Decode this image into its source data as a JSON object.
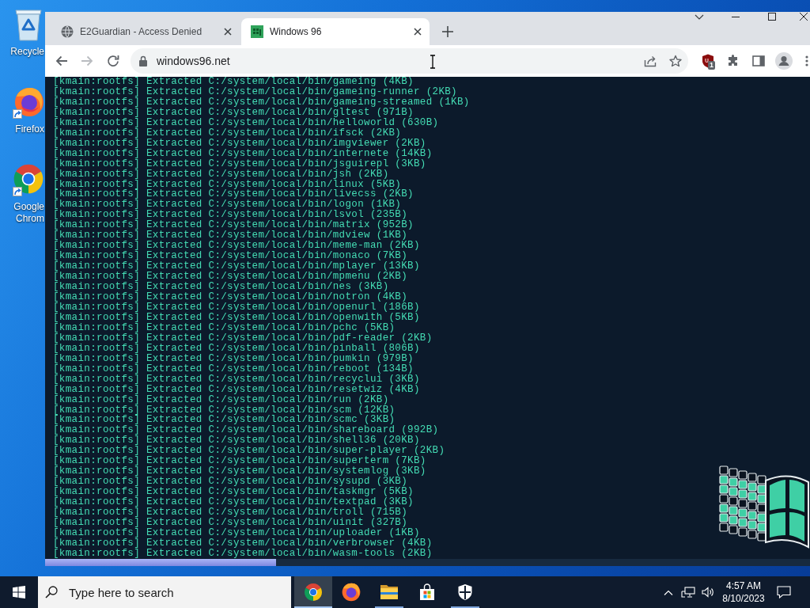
{
  "desktop": {
    "icons": [
      {
        "label": "Recycle",
        "shortcut": false
      },
      {
        "label": "Firefox",
        "shortcut": true
      },
      {
        "label": "Google Chrom",
        "shortcut": true
      }
    ]
  },
  "tabs": [
    {
      "title": "E2Guardian - Access Denied",
      "selected": false
    },
    {
      "title": "Windows 96",
      "selected": true
    }
  ],
  "toolbar": {
    "back_disabled": false,
    "forward_disabled": true,
    "url": "windows96.net",
    "extension_badge": "1"
  },
  "terminal": {
    "lines": [
      "[kmain:rootfs] Extracted C:/system/local/bin/gameing (4KB)",
      "[kmain:rootfs] Extracted C:/system/local/bin/gameing-runner (2KB)",
      "[kmain:rootfs] Extracted C:/system/local/bin/gameing-streamed (1KB)",
      "[kmain:rootfs] Extracted C:/system/local/bin/gltest (971B)",
      "[kmain:rootfs] Extracted C:/system/local/bin/helloworld (630B)",
      "[kmain:rootfs] Extracted C:/system/local/bin/ifsck (2KB)",
      "[kmain:rootfs] Extracted C:/system/local/bin/imgviewer (2KB)",
      "[kmain:rootfs] Extracted C:/system/local/bin/internete (14KB)",
      "[kmain:rootfs] Extracted C:/system/local/bin/jsguirepl (3KB)",
      "[kmain:rootfs] Extracted C:/system/local/bin/jsh (2KB)",
      "[kmain:rootfs] Extracted C:/system/local/bin/linux (5KB)",
      "[kmain:rootfs] Extracted C:/system/local/bin/livecss (2KB)",
      "[kmain:rootfs] Extracted C:/system/local/bin/logon (1KB)",
      "[kmain:rootfs] Extracted C:/system/local/bin/lsvol (235B)",
      "[kmain:rootfs] Extracted C:/system/local/bin/matrix (952B)",
      "[kmain:rootfs] Extracted C:/system/local/bin/mdview (1KB)",
      "[kmain:rootfs] Extracted C:/system/local/bin/meme-man (2KB)",
      "[kmain:rootfs] Extracted C:/system/local/bin/monaco (7KB)",
      "[kmain:rootfs] Extracted C:/system/local/bin/mplayer (13KB)",
      "[kmain:rootfs] Extracted C:/system/local/bin/mpmenu (2KB)",
      "[kmain:rootfs] Extracted C:/system/local/bin/nes (3KB)",
      "[kmain:rootfs] Extracted C:/system/local/bin/notron (4KB)",
      "[kmain:rootfs] Extracted C:/system/local/bin/openurl (186B)",
      "[kmain:rootfs] Extracted C:/system/local/bin/openwith (5KB)",
      "[kmain:rootfs] Extracted C:/system/local/bin/pchc (5KB)",
      "[kmain:rootfs] Extracted C:/system/local/bin/pdf-reader (2KB)",
      "[kmain:rootfs] Extracted C:/system/local/bin/pinball (806B)",
      "[kmain:rootfs] Extracted C:/system/local/bin/pumkin (979B)",
      "[kmain:rootfs] Extracted C:/system/local/bin/reboot (134B)",
      "[kmain:rootfs] Extracted C:/system/local/bin/recyclui (3KB)",
      "[kmain:rootfs] Extracted C:/system/local/bin/resetwiz (4KB)",
      "[kmain:rootfs] Extracted C:/system/local/bin/run (2KB)",
      "[kmain:rootfs] Extracted C:/system/local/bin/scm (12KB)",
      "[kmain:rootfs] Extracted C:/system/local/bin/scmc (3KB)",
      "[kmain:rootfs] Extracted C:/system/local/bin/shareboard (992B)",
      "[kmain:rootfs] Extracted C:/system/local/bin/shell36 (20KB)",
      "[kmain:rootfs] Extracted C:/system/local/bin/super-player (2KB)",
      "[kmain:rootfs] Extracted C:/system/local/bin/superterm (7KB)",
      "[kmain:rootfs] Extracted C:/system/local/bin/systemlog (3KB)",
      "[kmain:rootfs] Extracted C:/system/local/bin/sysupd (3KB)",
      "[kmain:rootfs] Extracted C:/system/local/bin/taskmgr (5KB)",
      "[kmain:rootfs] Extracted C:/system/local/bin/textpad (3KB)",
      "[kmain:rootfs] Extracted C:/system/local/bin/troll (715B)",
      "[kmain:rootfs] Extracted C:/system/local/bin/uinit (327B)",
      "[kmain:rootfs] Extracted C:/system/local/bin/uploader (1KB)",
      "[kmain:rootfs] Extracted C:/system/local/bin/verbrowser (4KB)",
      "[kmain:rootfs] Extracted C:/system/local/bin/wasm-tools (2KB)"
    ]
  },
  "taskbar": {
    "search": {
      "placeholder": "Type here to search"
    },
    "apps": [
      {
        "selected": true,
        "running": true
      },
      {
        "selected": false,
        "running": false
      },
      {
        "selected": false,
        "running": true
      },
      {
        "selected": false,
        "running": false
      },
      {
        "selected": false,
        "running": true
      }
    ],
    "clock": {
      "time": "4:57 AM",
      "date": "8/10/2023"
    }
  }
}
